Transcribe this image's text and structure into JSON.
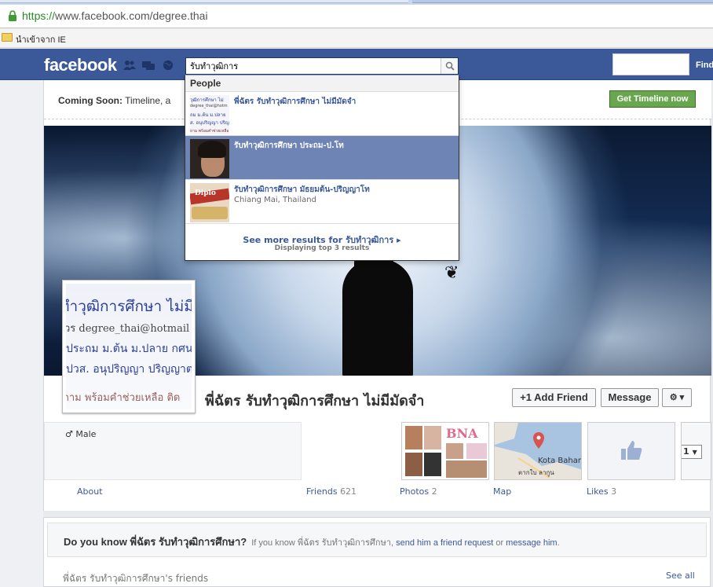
{
  "browser": {
    "url_scheme": "https://",
    "url_rest": "www.facebook.com/degree.thai",
    "bookmark_label": "นำเข้าจาก IE"
  },
  "fbbar": {
    "logo": "facebook",
    "search_value": "รับทำวุฒิการ",
    "find_label": "Find"
  },
  "search_dropdown": {
    "header": "People",
    "results": [
      {
        "name": "พี่ฉัตร รับทำวุฒิการศึกษา ไม่มีมัดจำ",
        "subtitle": ""
      },
      {
        "name": "รับทำวุฒิการศึกษา ประถม-ป.โท",
        "subtitle": ""
      },
      {
        "name": "รับทำวุฒิการศึกษา มัธยมต้น-ปริญญาโท",
        "subtitle": "Chiang Mai, Thailand"
      }
    ],
    "see_more": "See more results for รับทำวุฒิการ ▸",
    "displaying": "Displaying top 3 results"
  },
  "timeline_notice": {
    "label": "Coming Soon:",
    "text": "Timeline, a",
    "button": "Get Timeline now"
  },
  "profile": {
    "avatar_lines": [
      "ทำวุฒิการศึกษา ไม่มี",
      "วร degree_thai@hotmail",
      "ประถม ม.ต้น ม.ปลาย กศน",
      "ปวส. อนุปริญญา ปริญญาต",
      "ถาม พร้อมคำช่วยเหลือ ติด"
    ],
    "name": "พี่ฉัตร รับทำวุฒิการศึกษา ไม่มีมัดจำ",
    "add_friend": "+1 Add Friend",
    "message": "Message",
    "settings": "⚙ ▾",
    "gender": "♂ Male",
    "about": "About",
    "friends_label": "Friends",
    "friends_count": "621",
    "photos_label": "Photos",
    "photos_count": "2",
    "map_label": "Map",
    "likes_label": "Likes",
    "likes_count": "3",
    "photo_tile_text": "BNA",
    "map_text_1": "Kota Bahar",
    "map_text_2": "ตากใบ ลากูน",
    "select_value": "1"
  },
  "do_you_know": {
    "title": "Do you know พี่ฉัตร รับทำวุฒิการศึกษา?",
    "sub": "If you know พี่ฉัตร รับทำวุฒิการศึกษา,",
    "link1": "send him a friend request",
    "or": "or",
    "link2": "message him",
    "period": ".",
    "friends_heading": "พี่ฉัตร รับทำวุฒิการศึกษา's friends",
    "see_all": "See all"
  },
  "colors": {
    "fb_blue": "#3b5998",
    "link": "#3b5998",
    "highlight": "#6d84b4",
    "timeline_green": "#69a74e"
  }
}
